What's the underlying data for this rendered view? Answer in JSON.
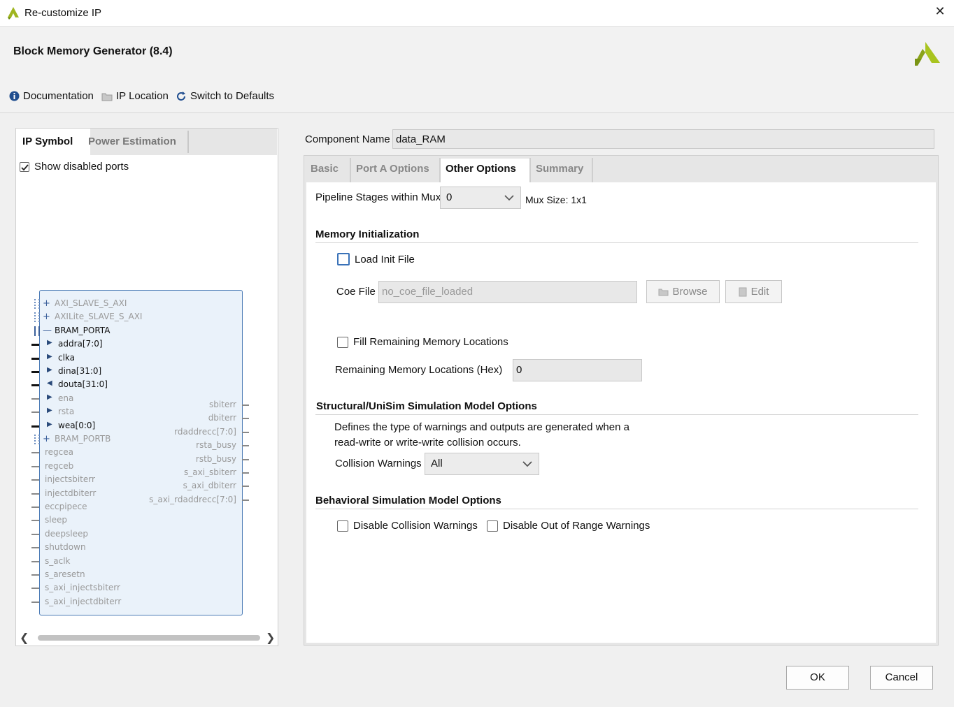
{
  "window": {
    "title": "Re-customize IP",
    "close_glyph": "✕"
  },
  "header": {
    "title": "Block Memory Generator (8.4)"
  },
  "toolbar": {
    "documentation": "Documentation",
    "ip_location": "IP Location",
    "switch_defaults": "Switch to Defaults"
  },
  "left": {
    "tabs": [
      "IP Symbol",
      "Power Estimation"
    ],
    "show_disabled_ports": "Show disabled ports",
    "show_disabled_checked": true,
    "ports_left": [
      {
        "label": "AXI_SLAVE_S_AXI",
        "active": false,
        "prefix": "+"
      },
      {
        "label": "AXILite_SLAVE_S_AXI",
        "active": false,
        "prefix": "+"
      },
      {
        "label": "BRAM_PORTA",
        "active": true,
        "prefix": "—"
      },
      {
        "label": "addra[7:0]",
        "active": true,
        "prefix": "▶"
      },
      {
        "label": "clka",
        "active": true,
        "prefix": "▶"
      },
      {
        "label": "dina[31:0]",
        "active": true,
        "prefix": "▶"
      },
      {
        "label": "douta[31:0]",
        "active": true,
        "prefix": "◀"
      },
      {
        "label": "ena",
        "active": false,
        "prefix": "▶"
      },
      {
        "label": "rsta",
        "active": false,
        "prefix": "▶"
      },
      {
        "label": "wea[0:0]",
        "active": true,
        "prefix": "▶"
      },
      {
        "label": "BRAM_PORTB",
        "active": false,
        "prefix": "+"
      },
      {
        "label": "regcea",
        "active": false,
        "prefix": ""
      },
      {
        "label": "regceb",
        "active": false,
        "prefix": ""
      },
      {
        "label": "injectsbiterr",
        "active": false,
        "prefix": ""
      },
      {
        "label": "injectdbiterr",
        "active": false,
        "prefix": ""
      },
      {
        "label": "eccpipece",
        "active": false,
        "prefix": ""
      },
      {
        "label": "sleep",
        "active": false,
        "prefix": ""
      },
      {
        "label": "deepsleep",
        "active": false,
        "prefix": ""
      },
      {
        "label": "shutdown",
        "active": false,
        "prefix": ""
      },
      {
        "label": "s_aclk",
        "active": false,
        "prefix": ""
      },
      {
        "label": "s_aresetn",
        "active": false,
        "prefix": ""
      },
      {
        "label": "s_axi_injectsbiterr",
        "active": false,
        "prefix": ""
      },
      {
        "label": "s_axi_injectdbiterr",
        "active": false,
        "prefix": ""
      }
    ],
    "ports_right": [
      "sbiterr",
      "dbiterr",
      "rdaddrecc[7:0]",
      "rsta_busy",
      "rstb_busy",
      "s_axi_sbiterr",
      "s_axi_dbiterr",
      "s_axi_rdaddrecc[7:0]"
    ]
  },
  "component": {
    "label": "Component Name",
    "value": "data_RAM"
  },
  "tabs": [
    "Basic",
    "Port A Options",
    "Other Options",
    "Summary"
  ],
  "active_tab": "Other Options",
  "pipeline": {
    "label": "Pipeline Stages within Mux",
    "value": "0",
    "mux_size": "Mux Size: 1x1"
  },
  "memory_init": {
    "heading": "Memory Initialization",
    "load_init_label": "Load Init File",
    "load_init_checked": false,
    "coe_label": "Coe File",
    "coe_value": "no_coe_file_loaded",
    "browse": "Browse",
    "edit": "Edit",
    "fill_label": "Fill Remaining Memory Locations",
    "fill_checked": false,
    "remaining_label": "Remaining Memory Locations (Hex)",
    "remaining_value": "0"
  },
  "structural": {
    "heading": "Structural/UniSim Simulation Model Options",
    "desc1": "Defines the type of warnings and outputs are generated when a",
    "desc2": "read-write or write-write collision occurs.",
    "collision_label": "Collision Warnings",
    "collision_value": "All"
  },
  "behavioral": {
    "heading": "Behavioral Simulation Model Options",
    "disable_collision": "Disable Collision Warnings",
    "disable_range": "Disable Out of Range Warnings"
  },
  "buttons": {
    "ok": "OK",
    "cancel": "Cancel"
  },
  "colors": {
    "logo": "#9fb520",
    "ip_border": "#4a7ab5",
    "ip_fill": "#eaf2fa",
    "focus_checkbox": "#3a72b8"
  }
}
